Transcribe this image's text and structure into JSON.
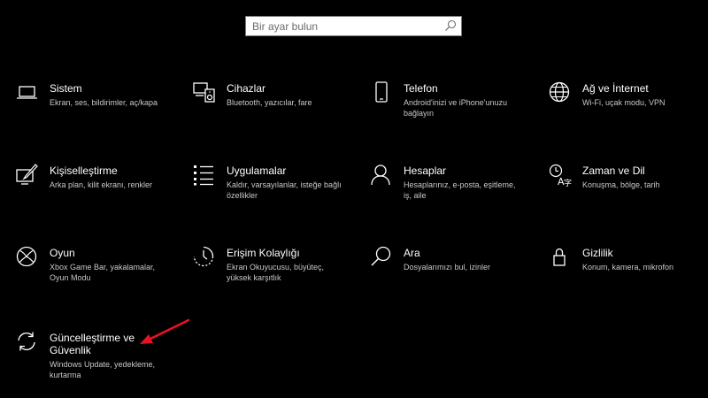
{
  "search": {
    "placeholder": "Bir ayar bulun"
  },
  "colors": {
    "background": "#000000",
    "text": "#ffffff",
    "description": "#c8c8c8",
    "annotation_arrow": "#e81123"
  },
  "tiles": [
    {
      "icon": "laptop-icon",
      "title": "Sistem",
      "description": "Ekran, ses, bildirimler, aç/kapa"
    },
    {
      "icon": "devices-icon",
      "title": "Cihazlar",
      "description": "Bluetooth, yazıcılar, fare"
    },
    {
      "icon": "phone-icon",
      "title": "Telefon",
      "description": "Android'inizi ve iPhone'unuzu bağlayın"
    },
    {
      "icon": "globe-icon",
      "title": "Ağ ve İnternet",
      "description": "Wi-Fi, uçak modu, VPN"
    },
    {
      "icon": "personalization-icon",
      "title": "Kişiselleştirme",
      "description": "Arka plan, kilit ekranı, renkler"
    },
    {
      "icon": "apps-list-icon",
      "title": "Uygulamalar",
      "description": "Kaldır, varsayılanlar, isteğe bağlı özellikler"
    },
    {
      "icon": "person-icon",
      "title": "Hesaplar",
      "description": "Hesaplarınız, e-posta, eşitleme, iş, aile"
    },
    {
      "icon": "language-icon",
      "title": "Zaman ve Dil",
      "description": "Konuşma, bölge, tarih"
    },
    {
      "icon": "xbox-icon",
      "title": "Oyun",
      "description": "Xbox Game Bar, yakalamalar, Oyun Modu"
    },
    {
      "icon": "accessibility-icon",
      "title": "Erişim Kolaylığı",
      "description": "Ekran Okuyucusu, büyüteç, yüksek karşıtlık"
    },
    {
      "icon": "search-icon",
      "title": "Ara",
      "description": "Dosyalarımızı bul, izinler"
    },
    {
      "icon": "lock-icon",
      "title": "Gizlilik",
      "description": "Konum, kamera, mikrofon"
    },
    {
      "icon": "sync-icon",
      "title": "Güncelleştirme ve Güvenlik",
      "description": "Windows Update, yedekleme, kurtarma"
    }
  ]
}
